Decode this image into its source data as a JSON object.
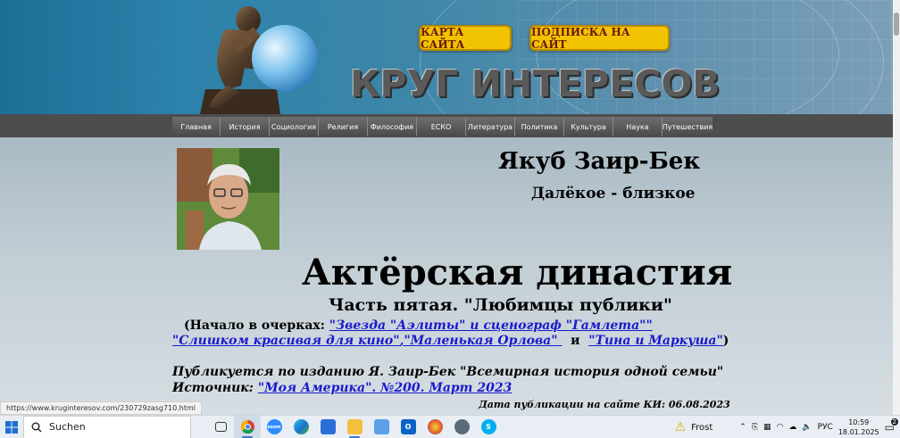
{
  "header": {
    "site_title": "КРУГ ИНТЕРЕСОВ",
    "btn_map": "КАРТА САЙТА",
    "btn_subscribe": "ПОДПИСКА НА САЙТ"
  },
  "nav": {
    "items": [
      "Главная",
      "История",
      "Социология",
      "Религия",
      "Философия",
      "ЕСКО",
      "Литература",
      "Политика",
      "Культура",
      "Наука",
      "Путешествия"
    ]
  },
  "article": {
    "author": "Якуб Заир-Бек",
    "series": "Далёкое - близкое",
    "title": "Актёрская династия",
    "subtitle": "Часть пятая. \"Любимцы публики\"",
    "ref_prefix": "(Начало в очерках: ",
    "ref_links": [
      "\"Звезда \"Аэлиты\" и сценограф \"Гамлета\"\"",
      "\"Слишком красивая для кино\"",
      ",\"Маленькая Орлова\" ",
      "\"Тина и Маркуша\""
    ],
    "ref_and": "  и  ",
    "ref_suffix": ")",
    "published": "Публикуется по изданию Я. Заир-Бек \"Всемирная история одной семьи\"",
    "source_label": "Источник: ",
    "source_link": "\"Моя Америка\". №200. Март 2023 ",
    "pub_date": "Дата публикации на сайте КИ: 06.08.2023"
  },
  "status_url": "https://www.kruginteresov.com/230729zasg710.html",
  "taskbar": {
    "search_placeholder": "Suchen",
    "weather": "Frost",
    "language": "РУС",
    "time": "10:59",
    "date": "18.01.2025",
    "notifications": "2",
    "apps": [
      "task-view",
      "chrome",
      "zoom",
      "edge",
      "store",
      "file-explorer",
      "notepad",
      "outlook",
      "paint",
      "misc-app",
      "skype"
    ]
  },
  "colors": {
    "accent_button": "#f2c300",
    "link": "#1a1acc",
    "nav_bg": "#4d4d4d"
  }
}
